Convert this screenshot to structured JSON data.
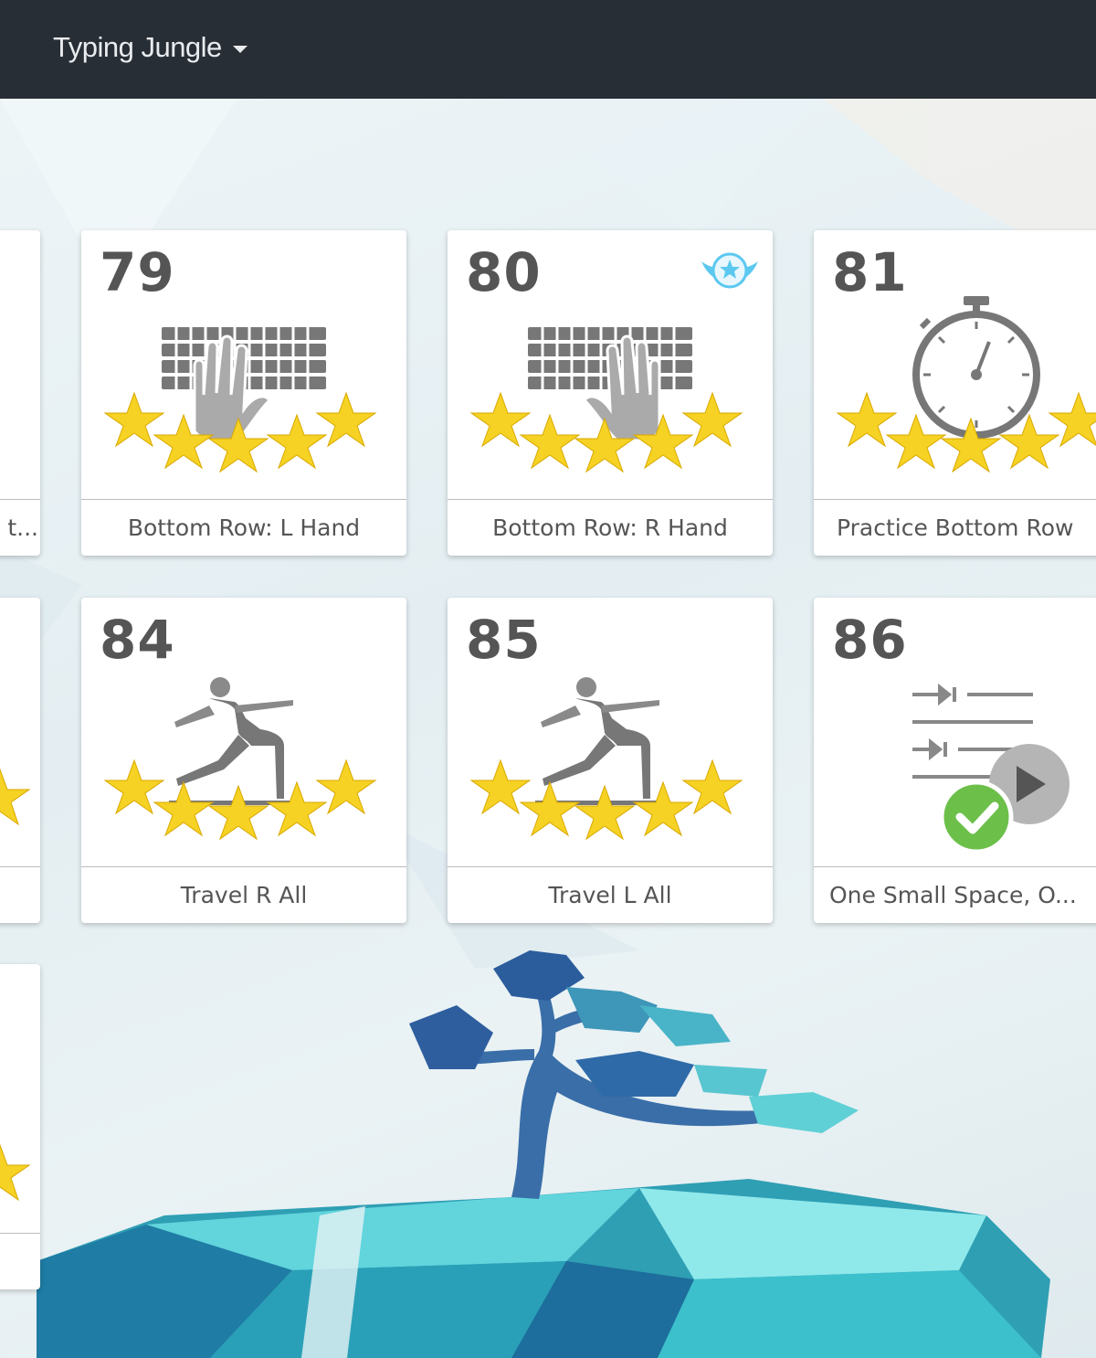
{
  "header": {
    "brand": "Typing Jungle",
    "brand_icon": "chevron-down-icon"
  },
  "lessons": [
    {
      "number": "79",
      "title": "Bottom Row: L Hand",
      "icon": "keyboard-hand-icon",
      "stars": 5,
      "badge": false
    },
    {
      "number": "80",
      "title": "Bottom Row: R Hand",
      "icon": "keyboard-hand-icon",
      "stars": 5,
      "badge": true
    },
    {
      "number": "81",
      "title": "Practice Bottom Row",
      "icon": "stopwatch-icon",
      "stars": 5,
      "badge": true
    },
    {
      "number": "84",
      "title": "Travel R All",
      "icon": "yoga-pose-icon",
      "stars": 5,
      "badge": false
    },
    {
      "number": "85",
      "title": "Travel L All",
      "icon": "yoga-pose-icon",
      "stars": 5,
      "badge": false
    },
    {
      "number": "86",
      "title": "One Small Space, O...",
      "icon": "tab-lines-icon",
      "stars": 0,
      "badge": false,
      "completed": true
    }
  ],
  "partial_left_cards": [
    {
      "title_tail": "t..."
    }
  ],
  "colors": {
    "topbar": "#282e36",
    "star": "#f5d223",
    "badge": "#5bc8f0",
    "check": "#6cc04a",
    "tree": "#3a6ea8",
    "island": "#3fb6c6"
  }
}
